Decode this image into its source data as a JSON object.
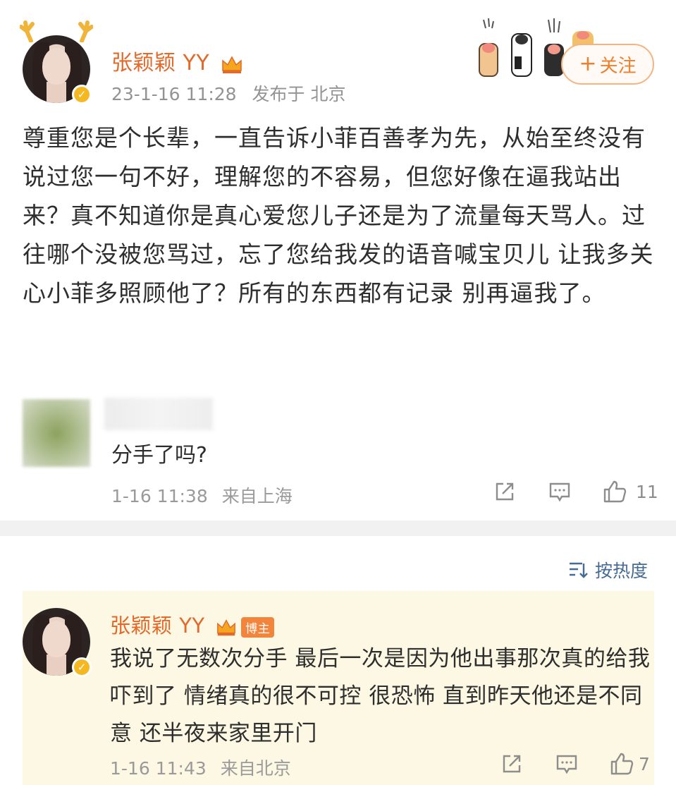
{
  "post": {
    "author": "张颖颖 YY",
    "date": "23-1-16 11:28",
    "location": "发布于 北京",
    "follow_label": "关注",
    "body": "尊重您是个长辈，一直告诉小菲百善孝为先，从始至终没有说过您一句不好，理解您的不容易，但您好像在逼我站出来？真不知道你是真心爱您儿子还是为了流量每天骂人。过往哪个没被您骂过，忘了您给我发的语音喊宝贝儿 让我多关心小菲多照顾他了？所有的东西都有记录 别再逼我了。"
  },
  "comment": {
    "text": "分手了吗?",
    "time": "1-16 11:38",
    "location": "来自上海",
    "likes": "11"
  },
  "sort": {
    "label": "按热度"
  },
  "reply": {
    "author": "张颖颖 YY",
    "badge": "博主",
    "text": "我说了无数次分手 最后一次是因为他出事那次真的给我吓到了 情绪真的很不可控 很恐怖  直到昨天他还是不同意 还半夜来家里开门",
    "time": "1-16 11:43",
    "location": "来自北京",
    "likes": "7"
  },
  "colors": {
    "username": "#e3692b",
    "follow": "#f07f2c",
    "sort": "#466b95",
    "reply_bg": "#fdf8e3",
    "verified": "#f6b821"
  },
  "icons": [
    "antler-icon",
    "verified-icon",
    "crown-icon",
    "paw-icon",
    "share-icon",
    "comment-icon",
    "like-icon",
    "sort-icon"
  ]
}
